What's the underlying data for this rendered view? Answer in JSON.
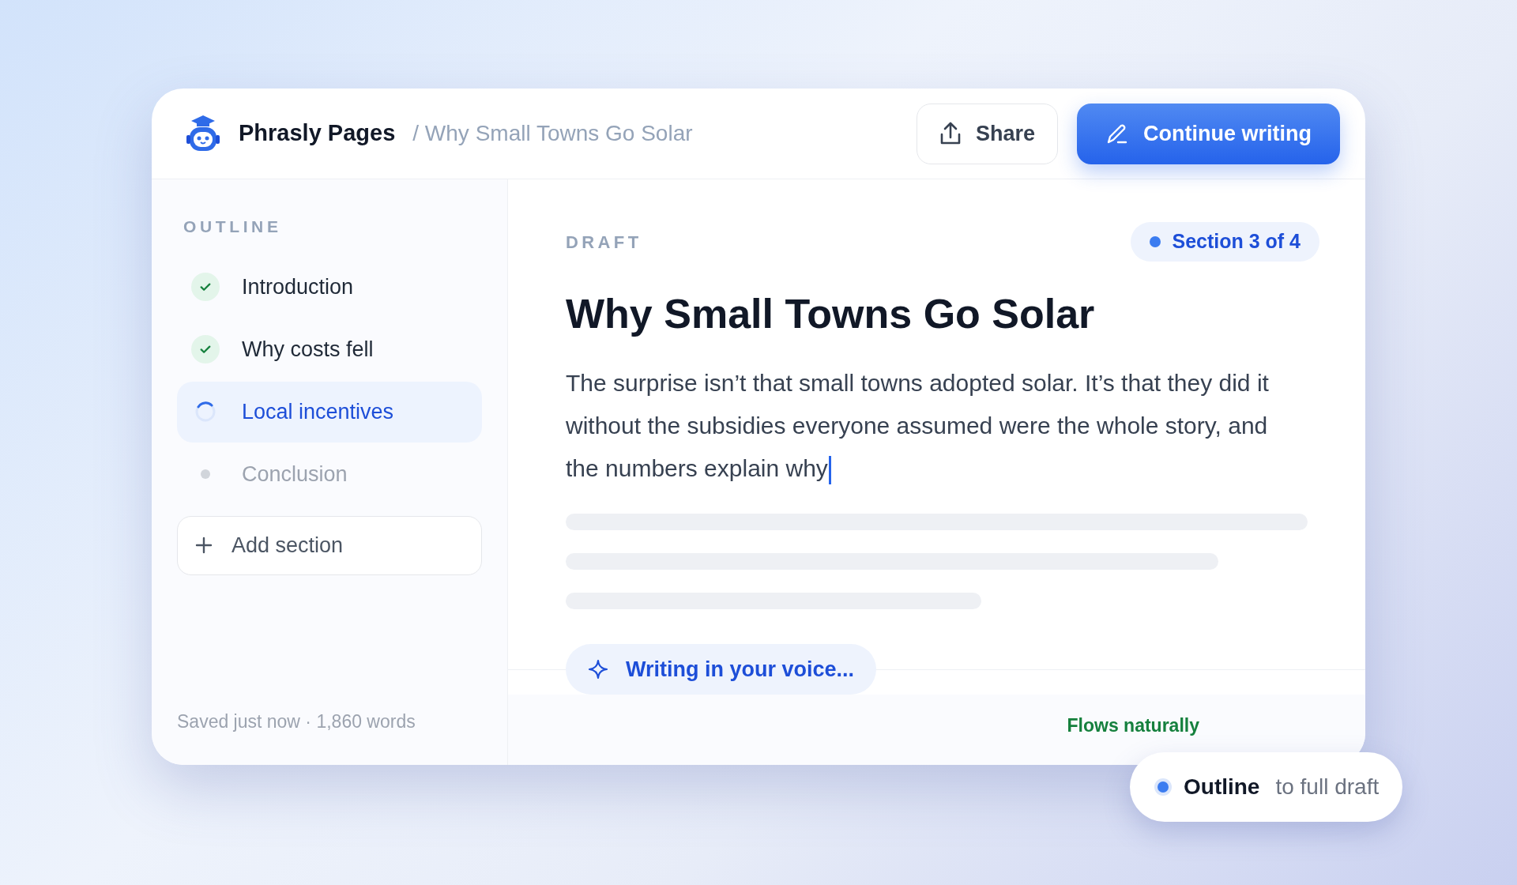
{
  "header": {
    "app_name": "Phrasly Pages",
    "breadcrumb": "/ Why Small Towns Go Solar",
    "share_button": "Share",
    "continue_button": "Continue writing"
  },
  "sidebar": {
    "heading": "OUTLINE",
    "items": [
      {
        "label": "Introduction",
        "kind": "done",
        "selected": false
      },
      {
        "label": "Why costs fell",
        "kind": "done",
        "selected": false
      },
      {
        "label": "Local incentives",
        "kind": "active",
        "selected": true
      },
      {
        "label": "Conclusion",
        "kind": "pending",
        "selected": false
      }
    ],
    "add_button": "Add section",
    "footer": "Saved just now · 1,860 words"
  },
  "editor": {
    "eyebrow": "DRAFT",
    "section_badge": "Section 3 of 4",
    "title": "Why Small Towns Go Solar",
    "body": "The surprise isn’t that small towns adopted solar. It’s that they did it without the subsidies everyone assumed were the whole story, and the numbers explain why",
    "writing_status": "Writing in your voice...",
    "quality_note": "Flows naturally"
  },
  "progress_pill": {
    "from": "Outline",
    "to": "to full draft"
  }
}
